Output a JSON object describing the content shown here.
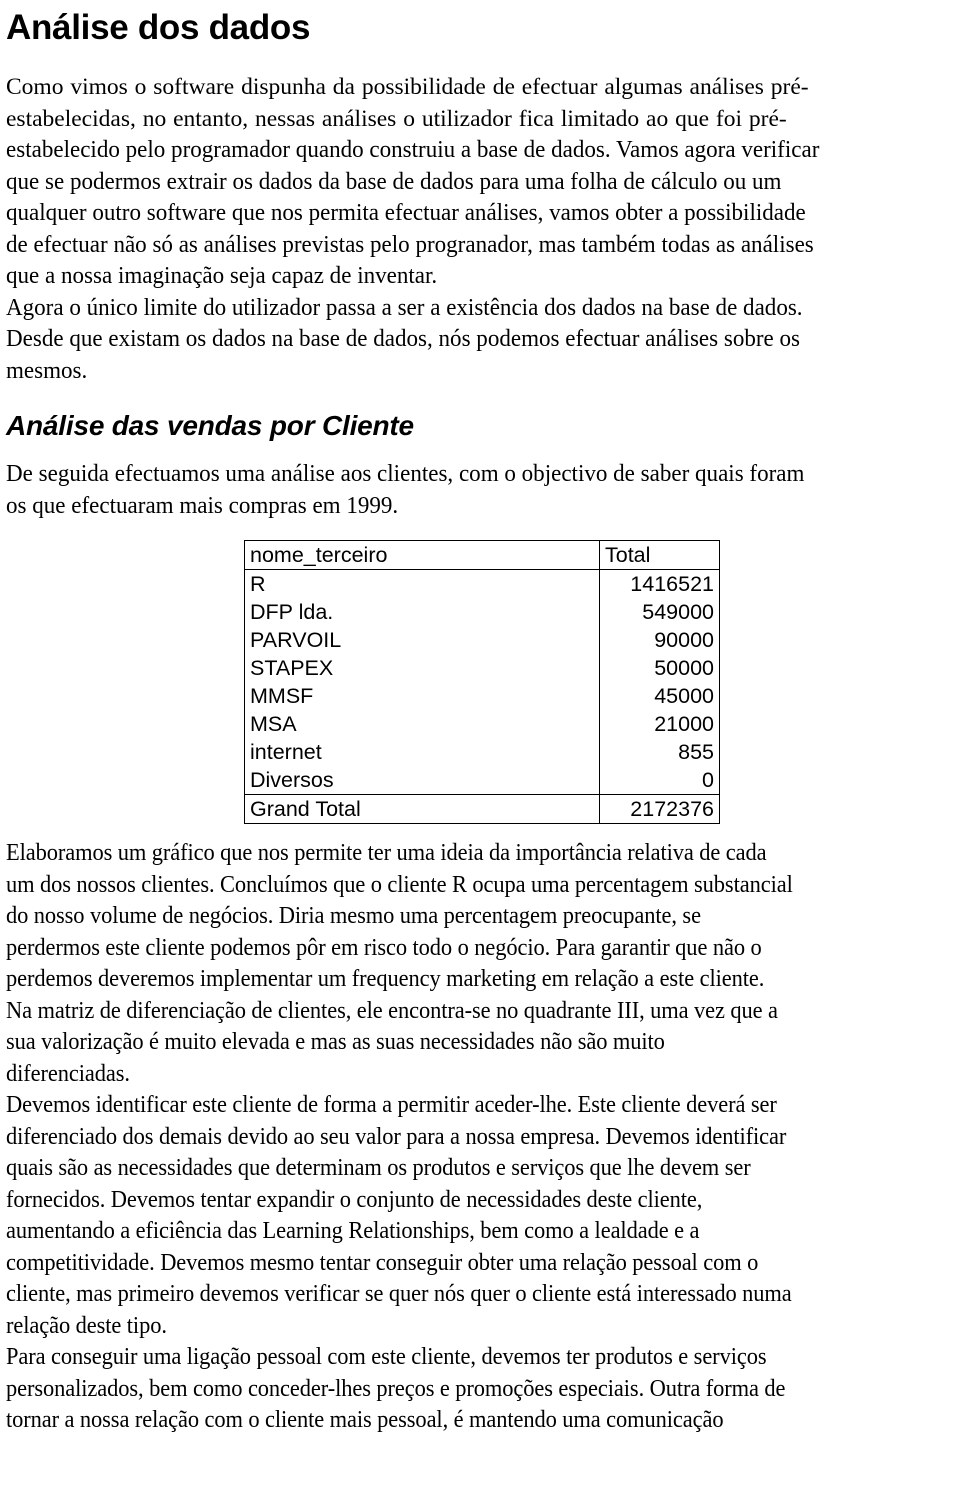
{
  "document": {
    "title": "Análise dos dados",
    "section_heading": "Análise das vendas por Cliente"
  },
  "intro": {
    "line1": "Como vimos o software dispunha da possibilidade de efectuar algumas análises pré-",
    "line2": "estabelecidas, no entanto, nessas análises o utilizador fica limitado ao que foi pré-",
    "line3": "estabelecido pelo programador quando construiu a base de dados. Vamos agora verificar",
    "line4": "que se podermos  extrair os dados da base de dados para uma folha de cálculo ou um",
    "line5": "qualquer outro software que nos permita efectuar análises, vamos obter a possibilidade",
    "line6": "de efectuar não só as análises previstas pelo progranador, mas também todas as análises",
    "line7": "que a nossa imaginação seja capaz de inventar.",
    "line8": "Agora o único limite do utilizador  passa a ser a existência dos dados na base de dados.",
    "line9": "Desde que existam os dados na base de dados, nós podemos efectuar análises sobre os",
    "line10": "mesmos."
  },
  "section_intro": {
    "line1": "De seguida efectuamos uma análise aos clientes, com o objectivo de saber quais foram",
    "line2": "os que efectuaram mais compras em 1999."
  },
  "pivot_table": {
    "columns": [
      "nome_terceiro",
      "Total"
    ],
    "rows": [
      {
        "name": "R",
        "total": "1416521"
      },
      {
        "name": "DFP lda.",
        "total": "549000"
      },
      {
        "name": "PARVOIL",
        "total": "90000"
      },
      {
        "name": "STAPEX",
        "total": "50000"
      },
      {
        "name": "MMSF",
        "total": "45000"
      },
      {
        "name": "MSA",
        "total": "21000"
      },
      {
        "name": "internet",
        "total": "855"
      },
      {
        "name": "Diversos",
        "total": "0"
      }
    ],
    "grand_total": {
      "name": "Grand Total",
      "total": "2172376"
    }
  },
  "analysis": {
    "p1_line1": "Elaboramos um gráfico que nos permite ter uma ideia da importância relativa de cada",
    "p1_line2": "um dos nossos clientes. Concluímos que o cliente R ocupa uma percentagem substancial",
    "p1_line3": "do nosso volume de negócios. Diria mesmo uma percentagem preocupante, se",
    "p1_line4": "perdermos este cliente podemos pôr em risco todo o negócio. Para garantir que não o",
    "p1_line5": "perdemos deveremos implementar um frequency marketing em relação a este cliente.",
    "p1_line6": "Na matriz de diferenciação de clientes, ele encontra-se no quadrante III, uma vez que a",
    "p1_line7": "sua valorização é muito elevada e mas as suas necessidades não são muito",
    "p1_line8": "diferenciadas.",
    "p2_line1": " Devemos identificar este cliente de forma a permitir aceder-lhe. Este cliente deverá ser",
    "p2_line2": "diferenciado dos demais devido ao seu valor para a nossa empresa. Devemos identificar",
    "p2_line3": "quais são as necessidades que determinam os produtos e serviços que lhe devem ser",
    "p2_line4": "fornecidos. Devemos tentar expandir o conjunto de necessidades deste cliente,",
    "p2_line5": "aumentando a eficiência das Learning Relationships, bem como a lealdade e a",
    "p2_line6": "competitividade. Devemos mesmo tentar conseguir obter uma relação pessoal com o",
    "p2_line7": "cliente, mas primeiro devemos verificar se quer nós quer o cliente está interessado numa",
    "p2_line8": "relação deste tipo.",
    "p3_line1": "Para conseguir uma ligação pessoal com este cliente, devemos ter produtos e serviços",
    "p3_line2": "personalizados, bem como conceder-lhes preços e promoções especiais. Outra forma de",
    "p3_line3": "tornar a nossa relação com o cliente mais pessoal, é mantendo uma comunicação"
  }
}
